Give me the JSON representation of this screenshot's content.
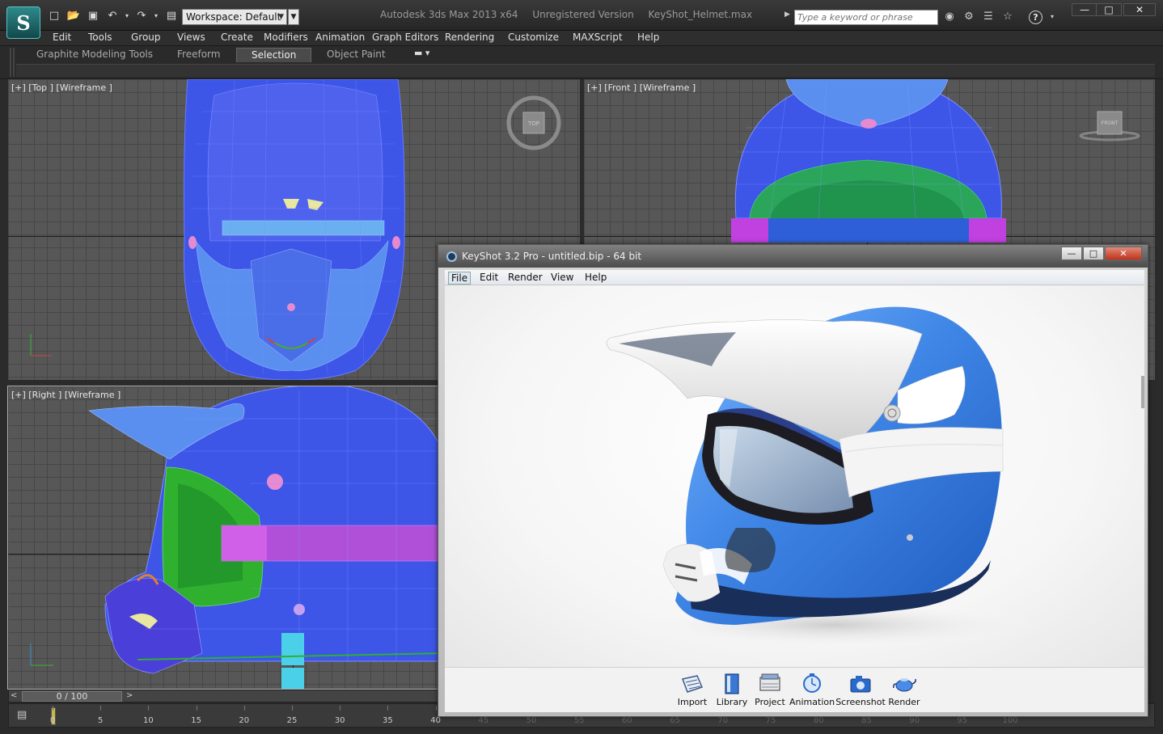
{
  "titlebar": {
    "logo": "3ds-max-logo",
    "quick_access": [
      "new-icon",
      "open-icon",
      "save-icon",
      "undo-icon",
      "redo-icon",
      "project-folder-icon"
    ],
    "workspace_value": "Workspace: Default",
    "title_app": "Autodesk 3ds Max  2013 x64",
    "title_status": "Unregistered Version",
    "title_file": "KeyShot_Helmet.max",
    "search_placeholder": "Type a keyword or phrase",
    "window_controls": [
      "minimize",
      "maximize",
      "close"
    ]
  },
  "menubar": {
    "items": [
      "Edit",
      "Tools",
      "Group",
      "Views",
      "Create",
      "Modifiers",
      "Animation",
      "Graph Editors",
      "Rendering",
      "Customize",
      "MAXScript",
      "Help"
    ]
  },
  "ribbon": {
    "tabs": [
      "Graphite Modeling Tools",
      "Freeform",
      "Selection",
      "Object Paint"
    ],
    "active_tab": "Selection"
  },
  "viewports": {
    "top": {
      "label": "[+] [Top ] [Wireframe ]",
      "viewcube": "TOP"
    },
    "front": {
      "label": "[+] [Front ] [Wireframe ]",
      "viewcube": "FRONT"
    },
    "right": {
      "label": "[+] [Right ] [Wireframe ]"
    }
  },
  "timeline": {
    "frame_readout": "0 / 100",
    "ticks": [
      "0",
      "5",
      "10",
      "15",
      "20",
      "25",
      "30",
      "35",
      "40",
      "45",
      "50",
      "55",
      "60",
      "65",
      "70",
      "75",
      "80",
      "85",
      "90",
      "95",
      "100"
    ]
  },
  "keyshot": {
    "title": "KeyShot 3.2 Pro  - untitled.bip  - 64 bit",
    "menu": [
      "File",
      "Edit",
      "Render",
      "View",
      "Help"
    ],
    "active_menu": "File",
    "toolbar": [
      {
        "label": "Import",
        "icon": "import-icon"
      },
      {
        "label": "Library",
        "icon": "library-icon"
      },
      {
        "label": "Project",
        "icon": "project-icon"
      },
      {
        "label": "Animation",
        "icon": "animation-icon"
      },
      {
        "label": "Screenshot",
        "icon": "screenshot-icon"
      },
      {
        "label": "Render",
        "icon": "render-teapot-icon"
      }
    ]
  },
  "colors": {
    "wire_blue": "#3d56e8",
    "wire_light_blue": "#5a8ff0",
    "wire_green": "#2fb02f",
    "wire_magenta": "#d040e0",
    "helmet_blue": "#3f86e6"
  }
}
